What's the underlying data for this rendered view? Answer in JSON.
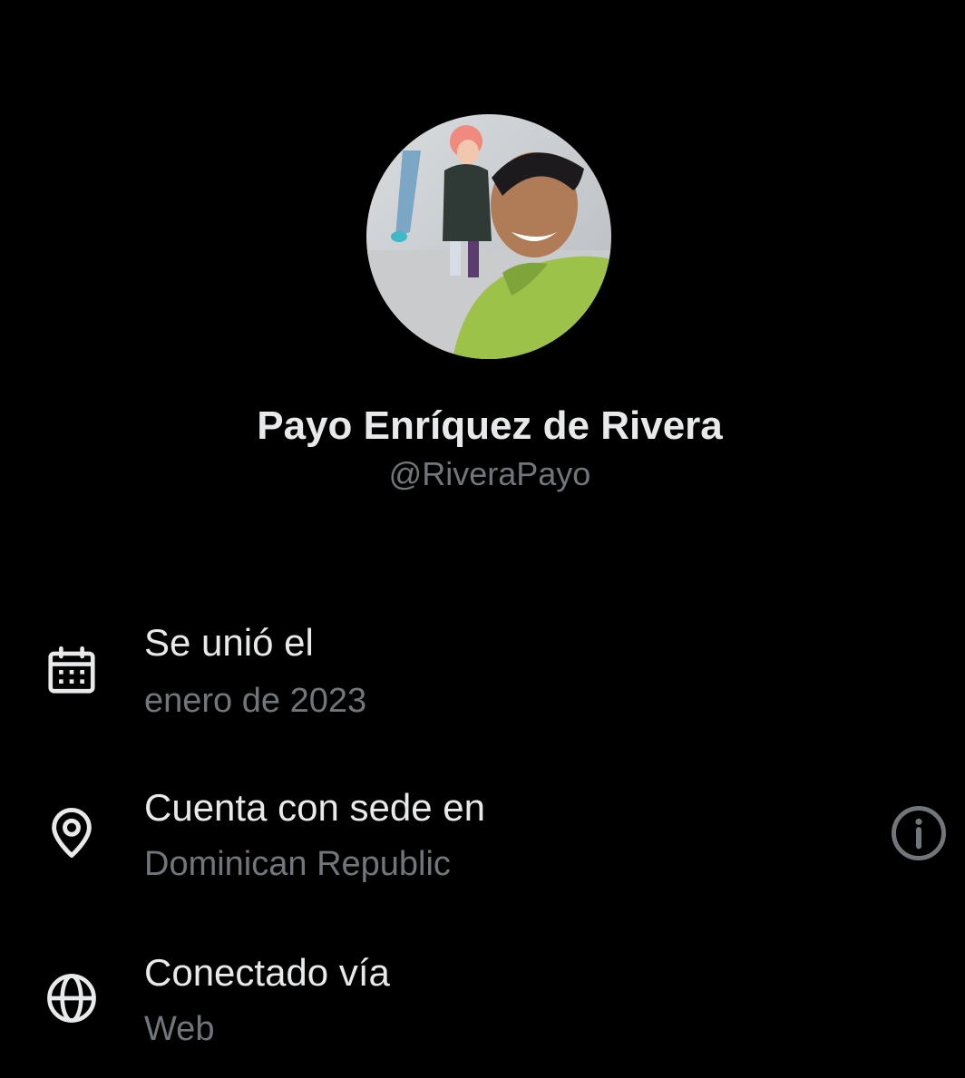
{
  "profile": {
    "display_name": "Payo Enríquez de Rivera",
    "handle": "@RiveraPayo"
  },
  "details": {
    "joined": {
      "icon": "calendar-icon",
      "title": "Se unió el",
      "value": "enero de 2023"
    },
    "location": {
      "icon": "location-pin-icon",
      "title": "Cuenta con sede en",
      "value": "Dominican Republic",
      "action_icon": "info-icon"
    },
    "connected": {
      "icon": "globe-icon",
      "title": "Conectado vía",
      "value": "Web"
    }
  },
  "colors": {
    "background": "#000000",
    "primary_text": "#e7e9ea",
    "secondary_text": "#71767b",
    "icon": "#e7e9ea"
  }
}
